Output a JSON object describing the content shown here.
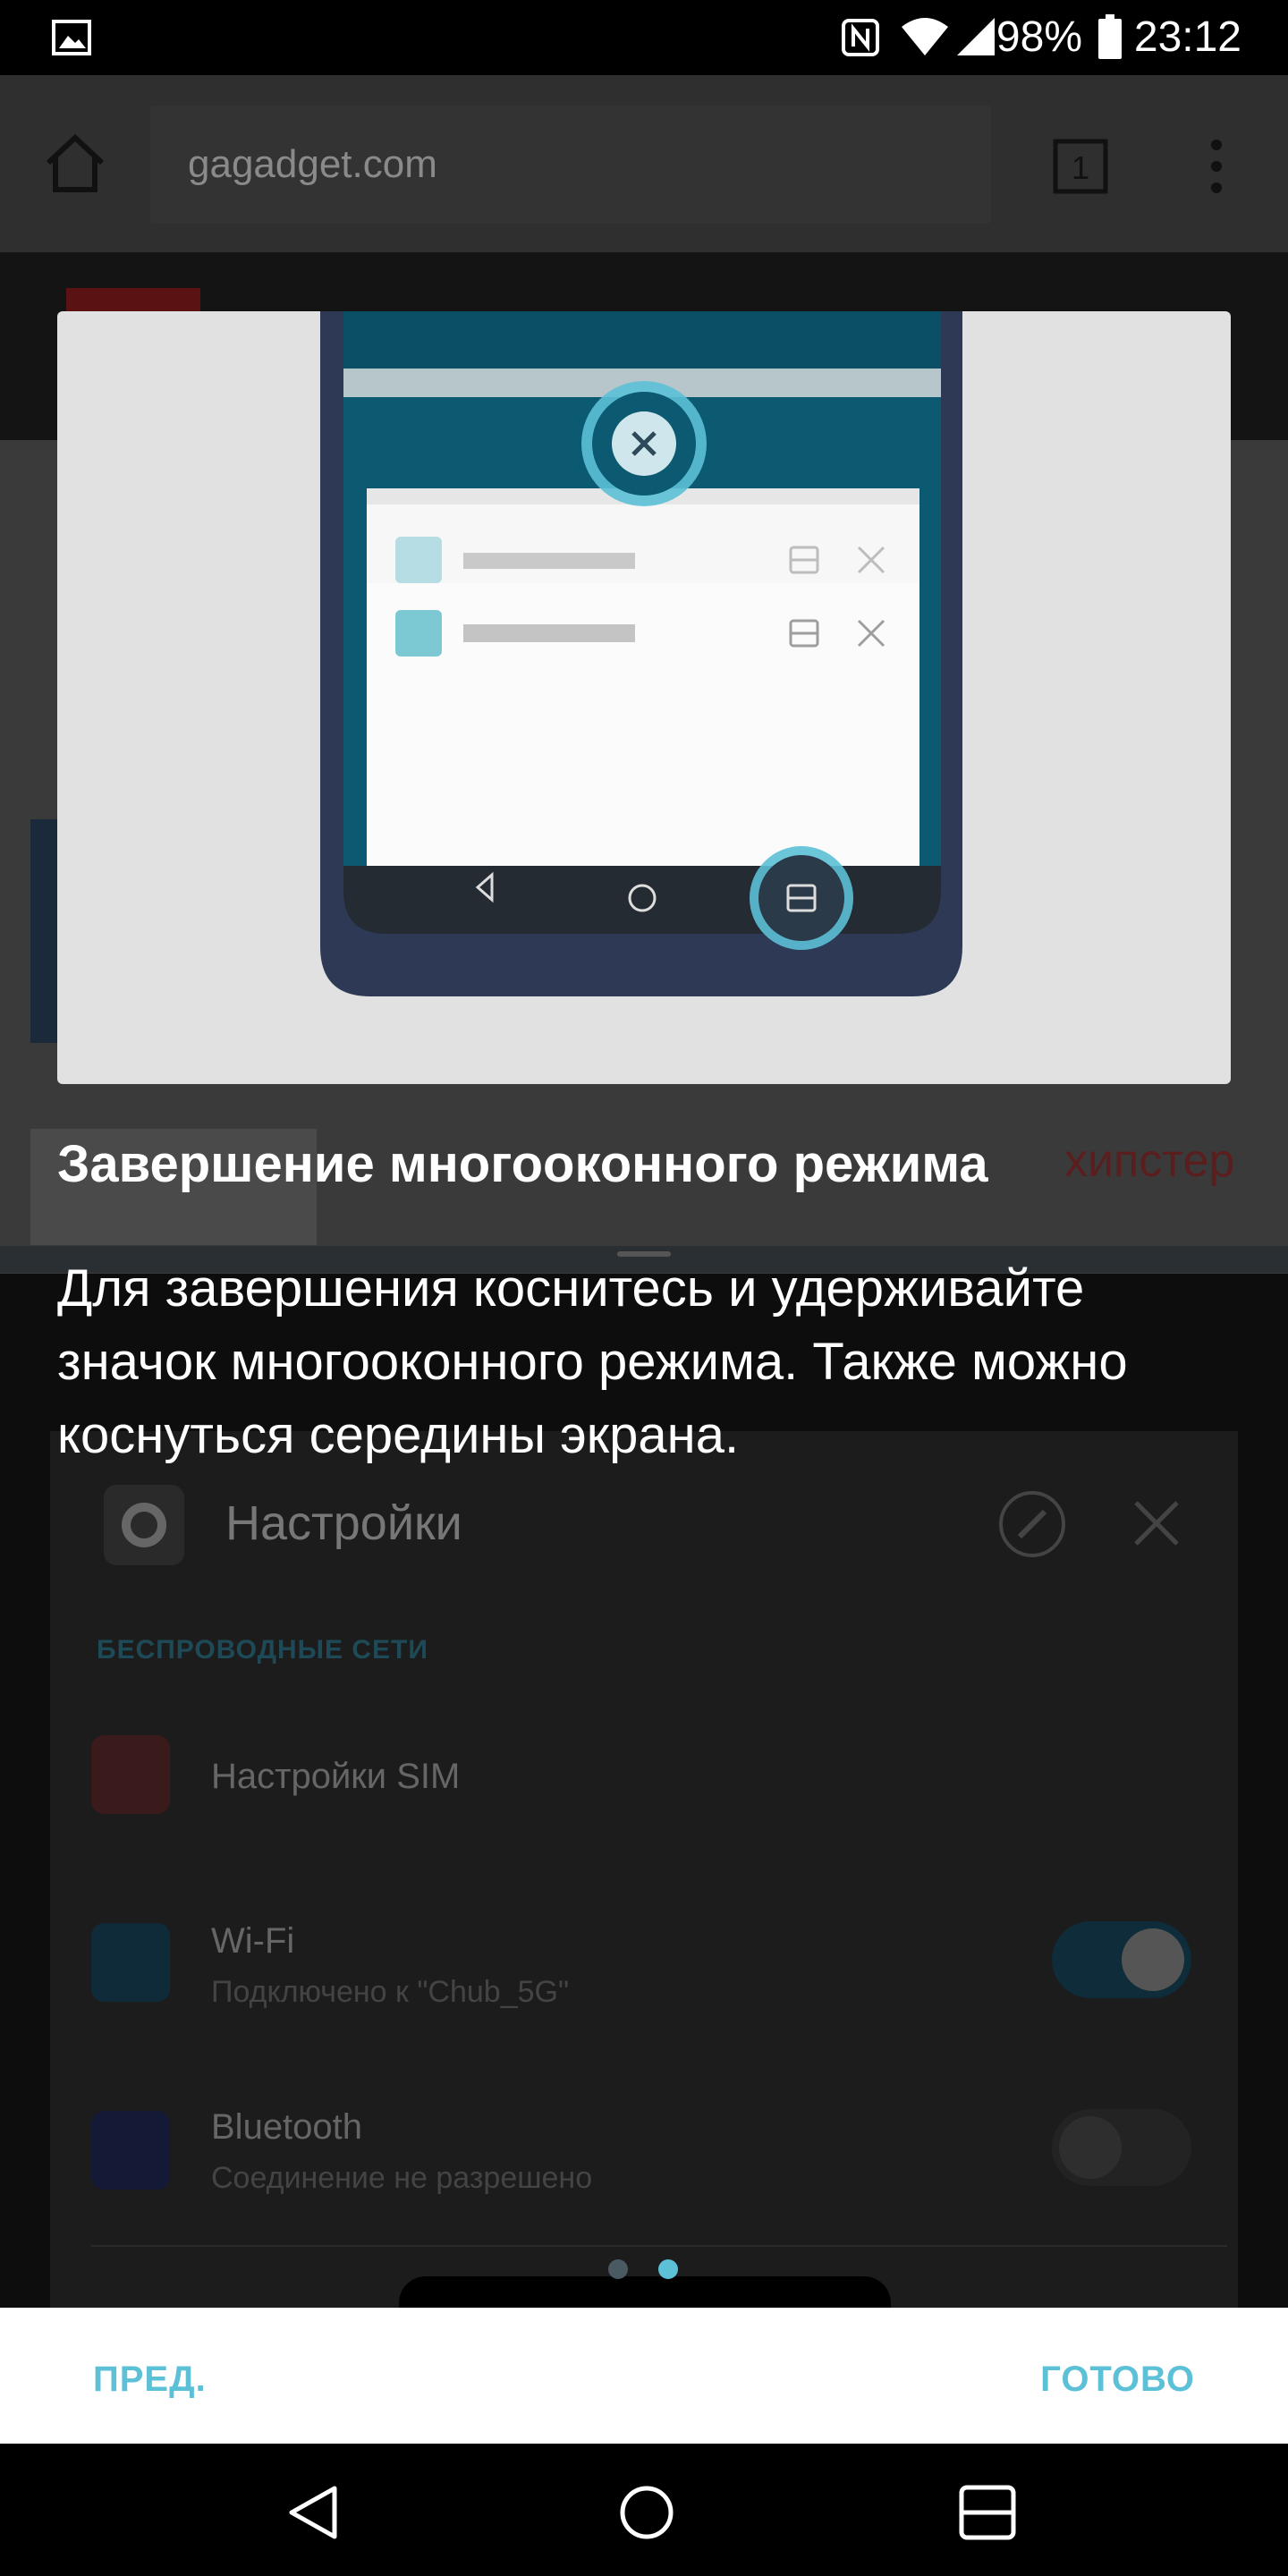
{
  "status_bar": {
    "battery_percent": "98%",
    "time": "23:12",
    "icons": [
      "image-notification-icon",
      "nfc-icon",
      "wifi-icon",
      "cell-signal-icon",
      "battery-icon"
    ]
  },
  "background_browser": {
    "url": "gagadget.com",
    "tab_count": "1",
    "article_snippet": "хипстер"
  },
  "tutorial": {
    "title": "Завершение многооконного режима",
    "description": "Для завершения коснитесь и удерживайте значок многооконного режима. Также можно коснуться середины экрана.",
    "pages": 2,
    "current_page": 2,
    "prev_label": "ПРЕД.",
    "done_label": "ГОТОВО",
    "accent_color": "#5cc0d6"
  },
  "background_settings": {
    "title": "Настройки",
    "section": "БЕСПРОВОДНЫЕ СЕТИ",
    "items": [
      {
        "label": "Настройки SIM",
        "sub": ""
      },
      {
        "label": "Wi-Fi",
        "sub": "Подключено к \"Chub_5G\""
      },
      {
        "label": "Bluetooth",
        "sub": "Соединение не разрешено"
      }
    ]
  },
  "nav_bar": {
    "buttons": [
      "back-icon",
      "home-icon",
      "recents-icon"
    ]
  }
}
